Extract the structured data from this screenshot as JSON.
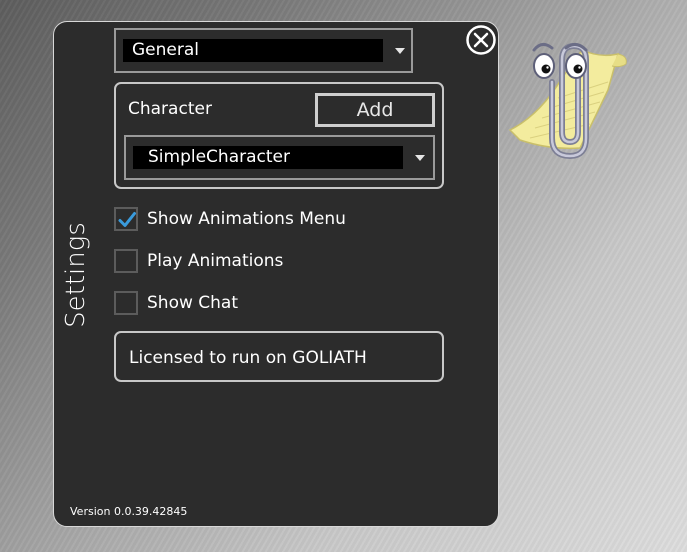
{
  "settings": {
    "title": "Settings",
    "category_selected": "General",
    "character_group": {
      "label": "Character",
      "add_label": "Add",
      "selected": "SimpleCharacter"
    },
    "options": [
      {
        "label": "Show Animations Menu",
        "checked": true
      },
      {
        "label": "Play Animations",
        "checked": false
      },
      {
        "label": "Show Chat",
        "checked": false
      }
    ],
    "license_text": "Licensed to run on GOLIATH",
    "version": "Version 0.0.39.42845"
  },
  "icons": {
    "close": "close-circle-icon",
    "dropdown": "chevron-down-icon",
    "check": "checkmark-icon",
    "assistant": "paperclip-assistant-icon"
  },
  "colors": {
    "panel_bg": "#2c2c2c",
    "accent_check": "#3a9bdc",
    "border": "#c8c8c8"
  }
}
